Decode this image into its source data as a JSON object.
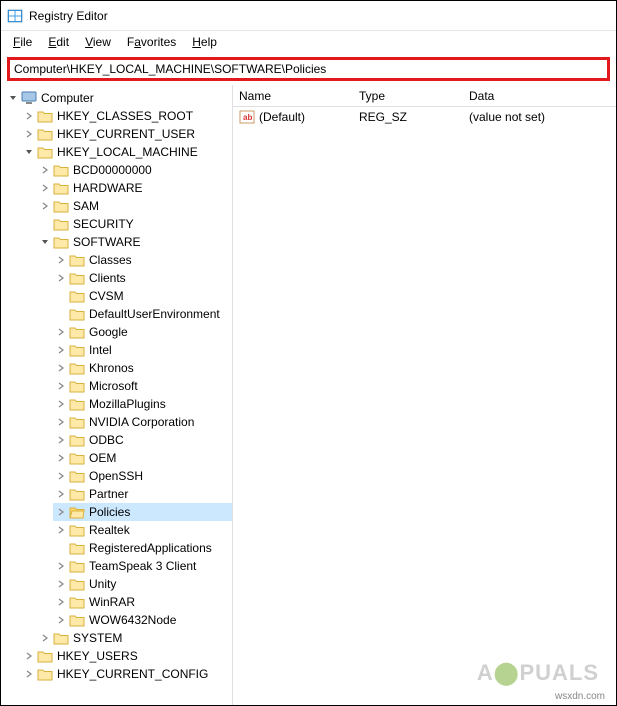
{
  "window": {
    "title": "Registry Editor"
  },
  "menu": {
    "file": "File",
    "edit": "Edit",
    "view": "View",
    "favorites": "Favorites",
    "help": "Help"
  },
  "address": "Computer\\HKEY_LOCAL_MACHINE\\SOFTWARE\\Policies",
  "tree": {
    "root": "Computer",
    "hives": {
      "hkcr": "HKEY_CLASSES_ROOT",
      "hkcu": "HKEY_CURRENT_USER",
      "hklm": "HKEY_LOCAL_MACHINE",
      "hku": "HKEY_USERS",
      "hkcc": "HKEY_CURRENT_CONFIG"
    },
    "hklm_children": {
      "bcd": "BCD00000000",
      "hardware": "HARDWARE",
      "sam": "SAM",
      "security": "SECURITY",
      "software": "SOFTWARE",
      "system": "SYSTEM"
    },
    "software_children": {
      "classes": "Classes",
      "clients": "Clients",
      "cvsm": "CVSM",
      "defaultuserenv": "DefaultUserEnvironment",
      "google": "Google",
      "intel": "Intel",
      "khronos": "Khronos",
      "microsoft": "Microsoft",
      "mozillaplugins": "MozillaPlugins",
      "nvidia": "NVIDIA Corporation",
      "odbc": "ODBC",
      "oem": "OEM",
      "openssh": "OpenSSH",
      "partner": "Partner",
      "policies": "Policies",
      "realtek": "Realtek",
      "registeredapps": "RegisteredApplications",
      "teamspeak": "TeamSpeak 3 Client",
      "unity": "Unity",
      "winrar": "WinRAR",
      "wow6432": "WOW6432Node"
    }
  },
  "list": {
    "headers": {
      "name": "Name",
      "type": "Type",
      "data": "Data"
    },
    "rows": [
      {
        "name": "(Default)",
        "type": "REG_SZ",
        "data": "(value not set)"
      }
    ]
  },
  "watermark": {
    "pre": "A",
    "post": "PUALS",
    "credit": "wsxdn.com"
  }
}
